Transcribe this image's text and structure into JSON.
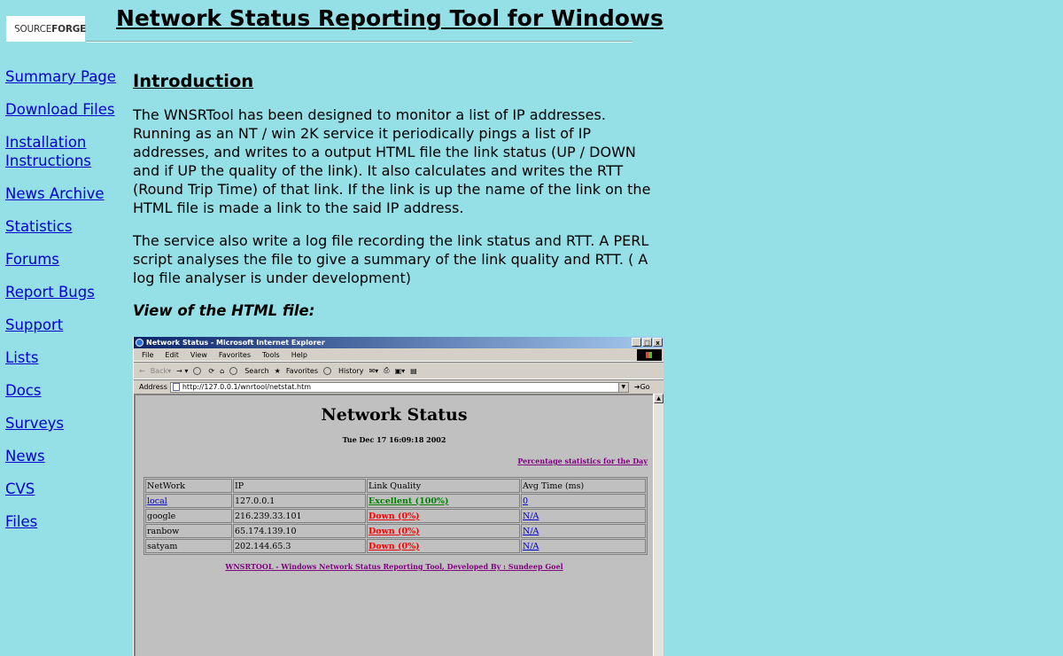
{
  "header": {
    "logo_part1": "SOURCE",
    "logo_part2": "FORGE",
    "title": "Network Status Reporting Tool for Windows"
  },
  "sidebar": {
    "items": [
      {
        "label": "Summary Page"
      },
      {
        "label": "Download Files"
      },
      {
        "label": "Installation Instructions"
      },
      {
        "label": "News Archive"
      },
      {
        "label": "Statistics"
      },
      {
        "label": "Forums"
      },
      {
        "label": "Report Bugs"
      },
      {
        "label": "Support"
      },
      {
        "label": "Lists"
      },
      {
        "label": "Docs"
      },
      {
        "label": "Surveys"
      },
      {
        "label": "News"
      },
      {
        "label": "CVS"
      },
      {
        "label": "Files"
      }
    ]
  },
  "main": {
    "heading": "Introduction",
    "para1": "The WNSRTool has been designed to monitor a list of IP addresses. Running as an NT / win 2K service it periodically pings a list of IP addresses, and writes to a output HTML file the link status (UP / DOWN and if UP the quality of the link). It also calculates and writes the RTT (Round Trip Time) of that link. If the link is up the name of the link on the HTML file is made a link to the said IP address.",
    "para2": "The service also write a log file recording the link status and RTT. A PERL script analyses the file to give a summary of the link quality and RTT. ( A log file analyser is under development)",
    "view_label": "View of the HTML file:"
  },
  "browser": {
    "window_title": "Network Status - Microsoft Internet Explorer",
    "window_buttons": [
      "_",
      "□",
      "x"
    ],
    "menu": [
      "File",
      "Edit",
      "View",
      "Favorites",
      "Tools",
      "Help"
    ],
    "toolbar": {
      "back": "Back",
      "search": "Search",
      "favorites": "Favorites",
      "history": "History"
    },
    "address_label": "Address",
    "address_value": "http://127.0.0.1/wnrtool/netstat.htm",
    "go_label": "Go",
    "page": {
      "title": "Network Status",
      "date": "Tue Dec 17 16:09:18 2002",
      "pct_link": "Percentage statistics for the Day",
      "columns": [
        "NetWork",
        "IP",
        "Link Quality",
        "Avg Time (ms)"
      ],
      "rows": [
        {
          "network": "local",
          "ip": "127.0.0.1",
          "quality": "Excellent (100%)",
          "avg": "0"
        },
        {
          "network": "google",
          "ip": "216.239.33.101",
          "quality": "Down (0%)",
          "avg": "N/A"
        },
        {
          "network": "ranbow",
          "ip": "65.174.139.10",
          "quality": "Down (0%)",
          "avg": "N/A"
        },
        {
          "network": "satyam",
          "ip": "202.144.65.3",
          "quality": "Down (0%)",
          "avg": "N/A"
        }
      ],
      "footer": "WNSRTOOL - Windows Network Status Reporting Tool, Developed By : Sundeep Goel"
    }
  }
}
